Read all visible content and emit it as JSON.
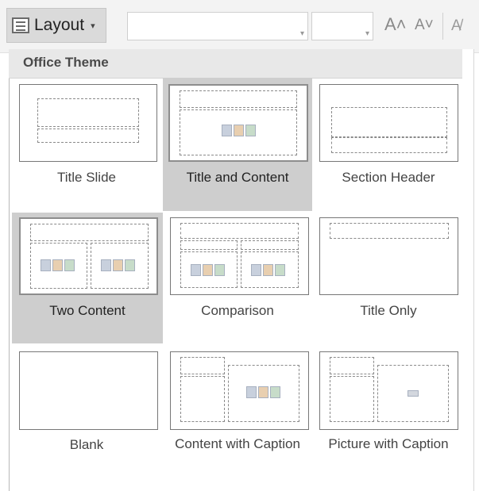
{
  "toolbar": {
    "layout_label": "Layout",
    "layout_caret": "▾",
    "grow_glyph": "A˄",
    "shrink_glyph": "A˅",
    "clear_glyph": "A̸"
  },
  "panel": {
    "header": "Office Theme",
    "selected_layout": "Title and Content",
    "hover_layout": "Two Content"
  },
  "layouts": [
    {
      "name": "Title Slide"
    },
    {
      "name": "Title and Content"
    },
    {
      "name": "Section Header"
    },
    {
      "name": "Two Content"
    },
    {
      "name": "Comparison"
    },
    {
      "name": "Title Only"
    },
    {
      "name": "Blank"
    },
    {
      "name": "Content with Caption"
    },
    {
      "name": "Picture with Caption"
    }
  ]
}
